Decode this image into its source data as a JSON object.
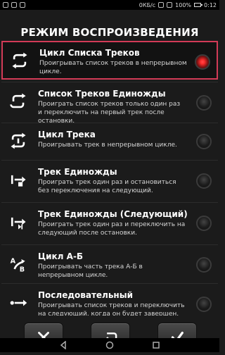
{
  "status": {
    "net": "0КБ/с",
    "battery": "100%",
    "time": "0:12"
  },
  "dialog": {
    "title": "РЕЖИМ ВОСПРОИЗВЕДЕНИЯ",
    "items": [
      {
        "name": "Цикл Списка Треков",
        "desc": "Проигрывать список треков в непрерывном цикле.",
        "icon": "repeat-all-icon",
        "selected": true
      },
      {
        "name": "Список Треков Единожды",
        "desc": "Проиграть список треков только один раз и переключить на первый трек после остановки.",
        "icon": "repeat-list-once-icon",
        "selected": false
      },
      {
        "name": "Цикл Трека",
        "desc": "Проигрывать трек в непрерывном цикле.",
        "icon": "repeat-one-icon",
        "selected": false
      },
      {
        "name": "Трек Единожды",
        "desc": "Проиграть трек один раз и остановиться без переключения на следующий.",
        "icon": "play-once-stop-icon",
        "selected": false
      },
      {
        "name": "Трек Единожды (Следующий)",
        "desc": "Проиграть трек один раз и переключить на следующий после остановки.",
        "icon": "play-once-next-icon",
        "selected": false
      },
      {
        "name": "Цикл А-Б",
        "desc": "Проигрывать часть трека А-Б в непрерывном цикле.",
        "icon": "ab-repeat-icon",
        "selected": false
      },
      {
        "name": "Последовательный",
        "desc": "Проигрывать список треков и переключить на следующий, когда он будет завершен.",
        "icon": "sequential-icon",
        "selected": false
      }
    ]
  },
  "buttons": {
    "cancel": "close-icon",
    "back": "back-icon",
    "ok": "check-icon"
  },
  "nav": {
    "back": "nav-back-icon",
    "home": "nav-home-icon",
    "recents": "nav-recents-icon"
  },
  "colors": {
    "accent": "#d23b57",
    "radio_on": "#ff2d2d"
  }
}
